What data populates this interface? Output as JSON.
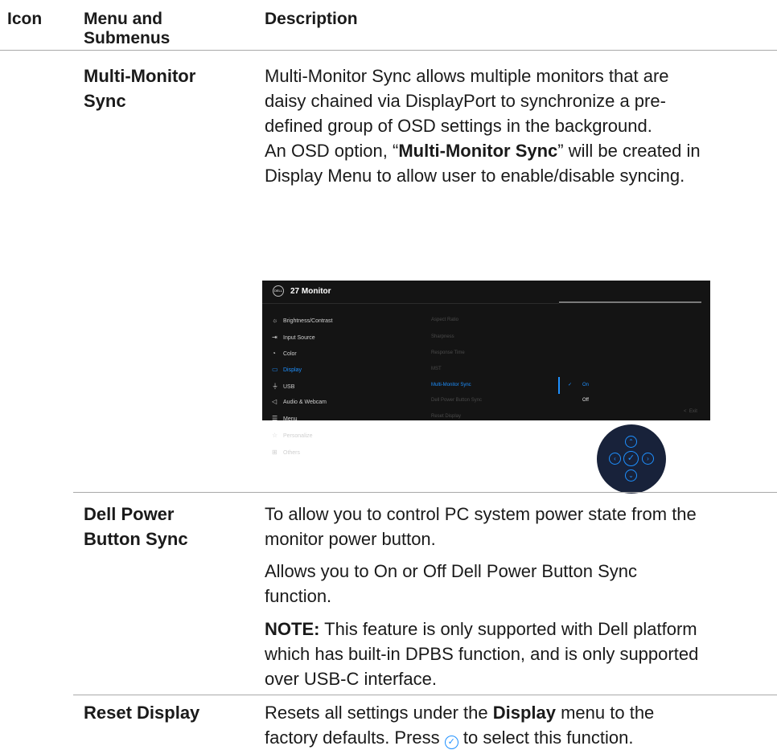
{
  "header": {
    "icon": "Icon",
    "menu": "Menu and Submenus",
    "menu_line1": "Menu and",
    "menu_line2": "Submenus",
    "description": "Description"
  },
  "rows": {
    "mms": {
      "menu_line1": "Multi-Monitor",
      "menu_line2": "Sync",
      "desc_line1": "Multi-Monitor Sync allows multiple monitors that are",
      "desc_line2": "daisy chained via DisplayPort to synchronize a pre-",
      "desc_line3": "defined group of OSD settings in the background.",
      "desc_line4_pre": "An OSD option, “",
      "desc_line4_bold": "Multi-Monitor Sync",
      "desc_line4_post": "” will be created in",
      "desc_line5": "Display Menu to allow user to enable/disable syncing."
    },
    "dpbs": {
      "menu_line1": "Dell Power",
      "menu_line2": "Button Sync",
      "p1_line1": "To allow you to control PC system power state from the",
      "p1_line2": "monitor power button.",
      "p2_line1": "Allows you to On or Off Dell Power Button Sync",
      "p2_line2": "function.",
      "note_label": "NOTE:",
      "note_line1": " This feature is only supported with Dell platform",
      "note_line2": "which has built-in DPBS function, and is only supported",
      "note_line3": "over USB-C interface."
    },
    "reset": {
      "menu": "Reset Display",
      "line1_pre": "Resets all settings under the ",
      "line1_bold": "Display",
      "line1_post": " menu to the",
      "line2_pre": "factory defaults. Press ",
      "line2_post": " to select this function."
    }
  },
  "osd": {
    "logo": "DELL",
    "title": "27 Monitor",
    "menu_items": [
      {
        "icon": "brightness-icon",
        "glyph": "☼",
        "label": "Brightness/Contrast"
      },
      {
        "icon": "input-source-icon",
        "glyph": "⇥",
        "label": "Input Source"
      },
      {
        "icon": "color-icon",
        "glyph": "◔",
        "label": "Color"
      },
      {
        "icon": "display-icon",
        "glyph": "▭",
        "label": "Display"
      },
      {
        "icon": "usb-icon",
        "glyph": "⏚",
        "label": "USB"
      },
      {
        "icon": "audio-webcam-icon",
        "glyph": "◁",
        "label": "Audio & Webcam"
      },
      {
        "icon": "menu-icon",
        "glyph": "☰",
        "label": "Menu"
      },
      {
        "icon": "personalize-icon",
        "glyph": "☆",
        "label": "Personalize"
      },
      {
        "icon": "others-icon",
        "glyph": "⊞",
        "label": "Others"
      }
    ],
    "sub_items": [
      "Aspect Ratio",
      "Sharpness",
      "Response Time",
      "MST",
      "Multi-Monitor Sync",
      "Dell Power Button Sync",
      "Reset Display"
    ],
    "options": [
      "On",
      "Off"
    ],
    "check": "✓",
    "exit": "Exit",
    "exit_glyph": "<",
    "accent_color": "#1e90ff"
  },
  "joystick": {
    "up": "⌃",
    "down": "⌄",
    "left": "‹",
    "right": "›",
    "center": "✓"
  }
}
